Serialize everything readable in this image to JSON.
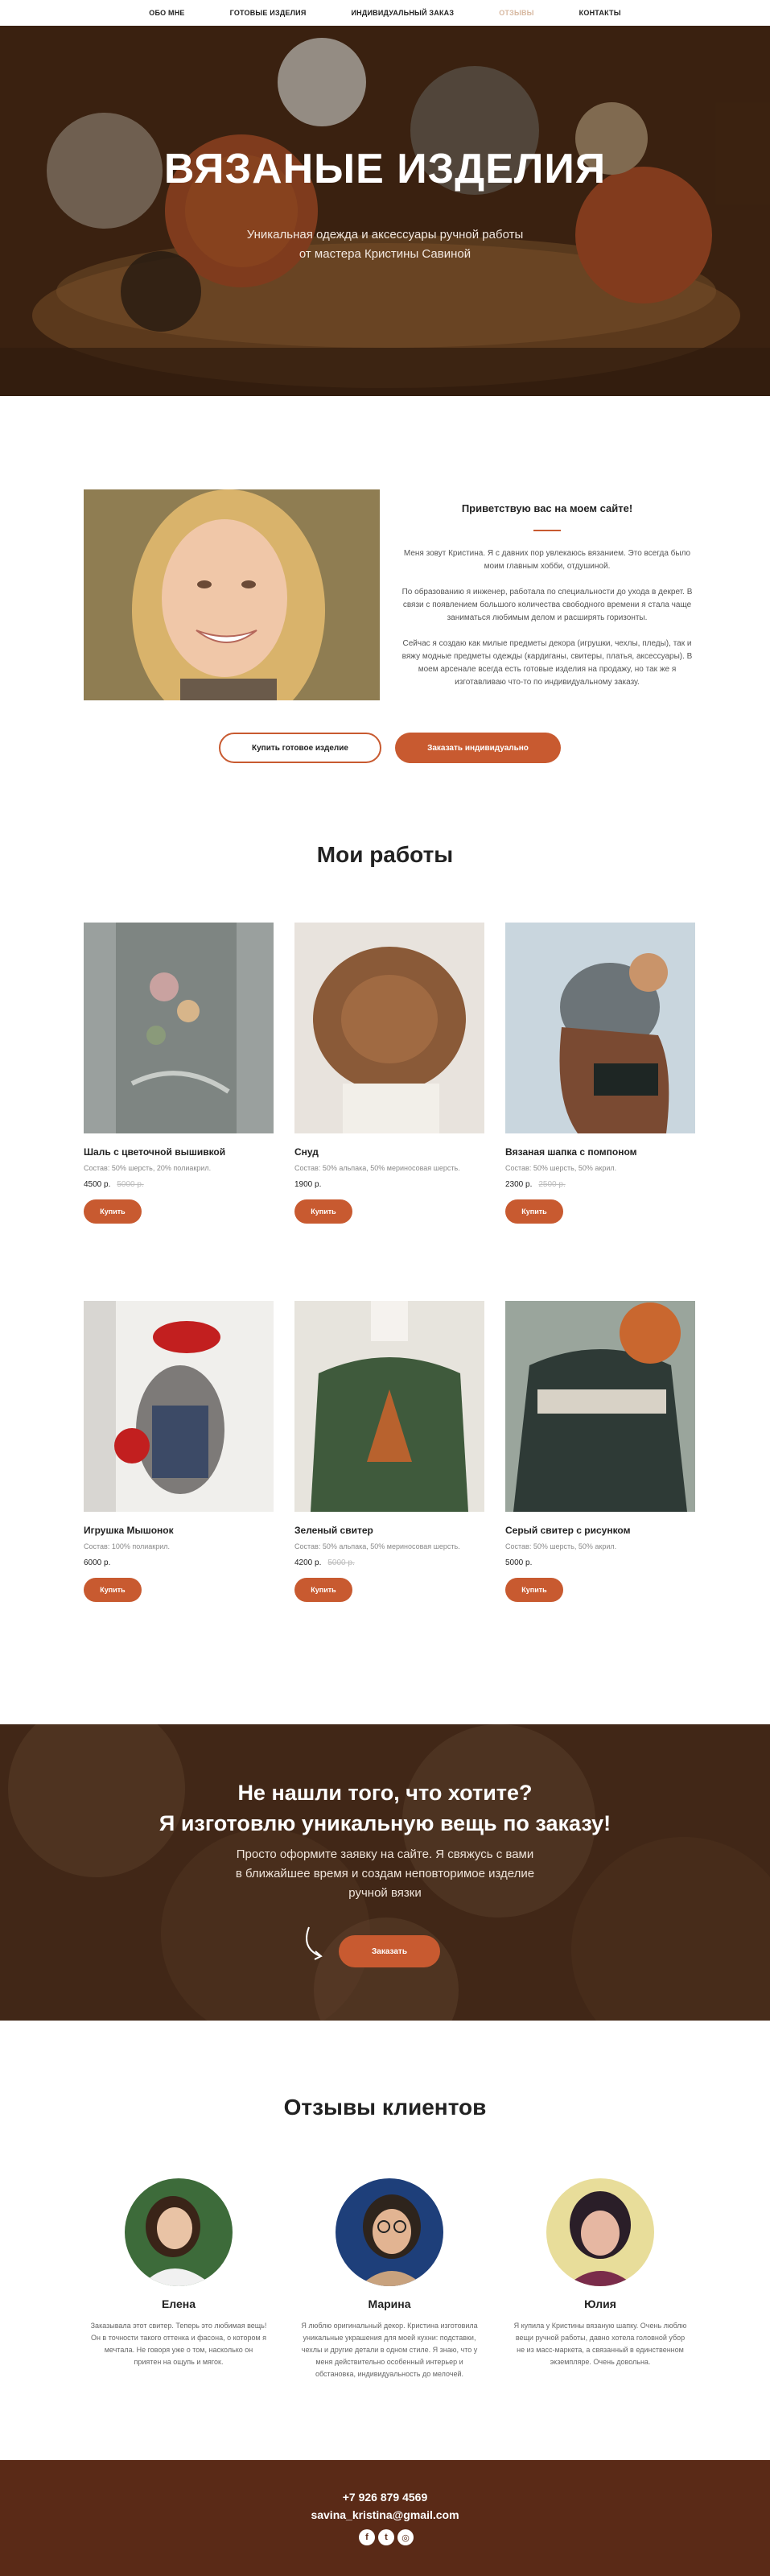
{
  "nav": {
    "items": [
      {
        "label": "ОБО МНЕ",
        "active": false
      },
      {
        "label": "ГОТОВЫЕ ИЗДЕЛИЯ",
        "active": false
      },
      {
        "label": "ИНДИВИДУАЛЬНЫЙ ЗАКАЗ",
        "active": false
      },
      {
        "label": "ОТЗЫВЫ",
        "active": true
      },
      {
        "label": "КОНТАКТЫ",
        "active": false
      }
    ]
  },
  "hero": {
    "title": "ВЯЗАНЫЕ ИЗДЕЛИЯ",
    "subtitle_line1": "Уникальная одежда и аксессуары ручной работы",
    "subtitle_line2": "от мастера Кристины Савиной"
  },
  "about": {
    "title": "Приветствую вас на моем сайте!",
    "p1": "Меня зовут Кристина. Я с давних пор увлекаюсь вязанием. Это всегда было моим главным хобби, отдушиной.",
    "p2": "По образованию я инженер, работала по специальности до ухода в декрет. В связи с появлением большого количества свободного времени я стала чаще заниматься любимым делом и расширять горизонты.",
    "p3": "Сейчас я создаю как милые предметы декора (игрушки, чехлы, пледы), так и вяжу модные предметы одежды (кардиганы, свитеры, платья, аксессуары). В моем арсенале всегда есть готовые изделия на продажу, но так же я изготавливаю что-то по индивидуальному заказу.",
    "btn_ready": "Купить готовое изделие",
    "btn_custom": "Заказать индивидуально"
  },
  "works": {
    "title": "Мои работы",
    "buy_label": "Купить",
    "items": [
      {
        "name": "Шаль с цветочной вышивкой",
        "composition": "Состав: 50% шерсть, 20% полиакрил.",
        "price": "4500 р.",
        "old_price": "5000 р."
      },
      {
        "name": "Снуд",
        "composition": "Состав: 50% альпака, 50% мериносовая шерсть.",
        "price": "1900 р.",
        "old_price": ""
      },
      {
        "name": "Вязаная шапка с помпоном",
        "composition": "Состав: 50% шерсть, 50% акрил.",
        "price": "2300 р.",
        "old_price": "2500 р."
      },
      {
        "name": "Игрушка Мышонок",
        "composition": "Состав: 100% полиакрил.",
        "price": "6000 р.",
        "old_price": ""
      },
      {
        "name": "Зеленый свитер",
        "composition": "Состав: 50% альпака, 50% мериносовая шерсть.",
        "price": "4200 р.",
        "old_price": "5000 р."
      },
      {
        "name": "Серый свитер с рисунком",
        "composition": "Состав: 50% шерсть, 50% акрил.",
        "price": "5000 р.",
        "old_price": ""
      }
    ]
  },
  "cta": {
    "title_line1": "Не нашли того, что хотите?",
    "title_line2": "Я изготовлю уникальную вещь по заказу!",
    "sub_line1": "Просто оформите заявку на сайте. Я свяжусь с вами",
    "sub_line2": "в ближайшее время и создам неповторимое изделие",
    "sub_line3": "ручной вязки",
    "button": "Заказать"
  },
  "reviews": {
    "title": "Отзывы клиентов",
    "items": [
      {
        "name": "Елена",
        "text": "Заказывала этот свитер. Теперь это любимая вещь! Он в точности такого оттенка и фасона, о котором я мечтала. Не говоря уже о том, насколько он приятен на ощупь и мягок."
      },
      {
        "name": "Марина",
        "text": "Я люблю оригинальный декор. Кристина изготовила уникальные украшения для моей кухни: подставки, чехлы и другие детали в одном стиле. Я знаю, что у меня действительно особенный интерьер и обстановка, индивидуальность до мелочей."
      },
      {
        "name": "Юлия",
        "text": "Я купила у Кристины вязаную шапку. Очень люблю вещи ручной работы, давно хотела головной убор не из масс-маркета, а связанный в единственном экземпляре. Очень довольна."
      }
    ]
  },
  "footer": {
    "phone": "+7 926 879 4569",
    "email": "savina_kristina@gmail.com",
    "socials": [
      {
        "icon": "facebook-icon",
        "glyph": "f"
      },
      {
        "icon": "twitter-icon",
        "glyph": "t"
      },
      {
        "icon": "instagram-icon",
        "glyph": "◎"
      }
    ]
  },
  "colors": {
    "accent": "#c85a30",
    "footer_bg": "#5a2a17",
    "nav_active": "#d7b8a0"
  }
}
